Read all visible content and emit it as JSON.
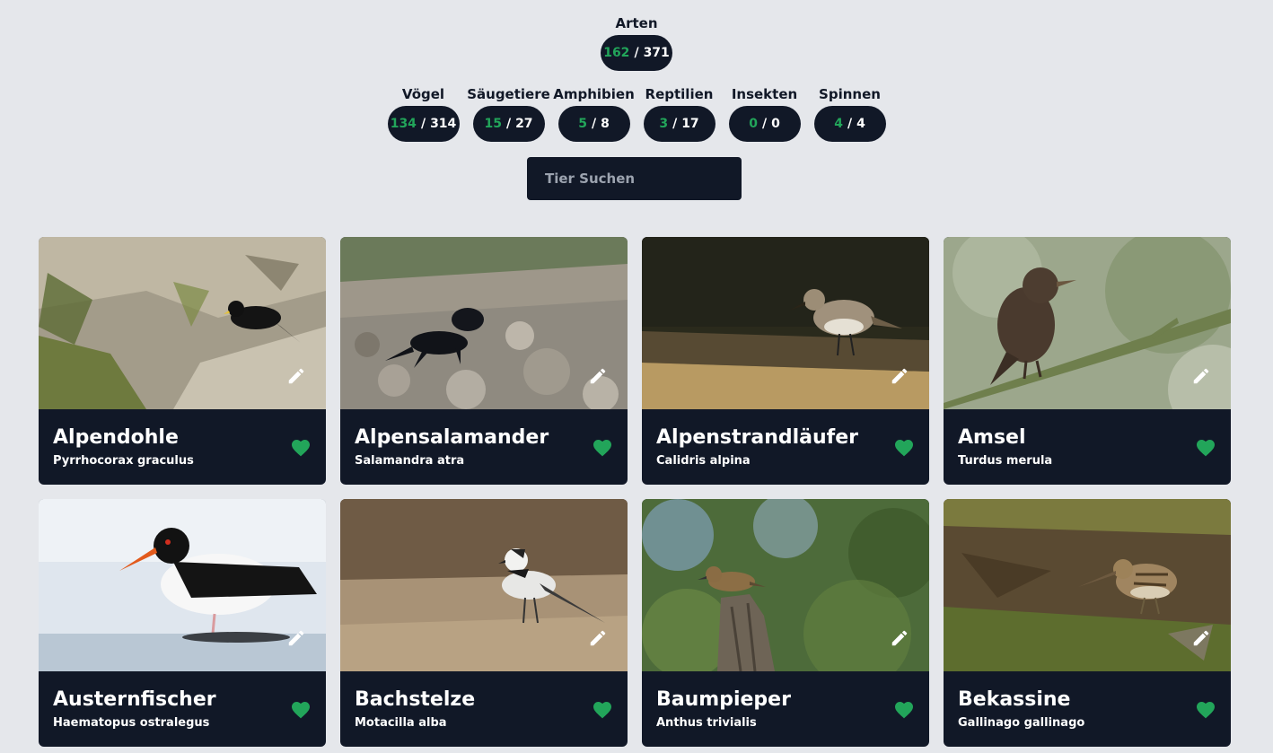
{
  "summary": {
    "label": "Arten",
    "found": "162",
    "total": "371"
  },
  "categories": [
    {
      "label": "Vögel",
      "found": "134",
      "total": "314"
    },
    {
      "label": "Säugetiere",
      "found": "15",
      "total": "27"
    },
    {
      "label": "Amphibien",
      "found": "5",
      "total": "8"
    },
    {
      "label": "Reptilien",
      "found": "3",
      "total": "17"
    },
    {
      "label": "Insekten",
      "found": "0",
      "total": "0"
    },
    {
      "label": "Spinnen",
      "found": "4",
      "total": "4"
    }
  ],
  "search": {
    "placeholder": "Tier Suchen"
  },
  "colors": {
    "background": "#e5e7eb",
    "panel": "#111827",
    "found": "#22a55a",
    "heart": "#22a55a"
  },
  "icons": {
    "edit": "pencil-icon",
    "favorite": "heart-icon"
  },
  "cards": [
    {
      "name": "Alpendohle",
      "latin": "Pyrrhocorax graculus"
    },
    {
      "name": "Alpensalamander",
      "latin": "Salamandra atra"
    },
    {
      "name": "Alpenstrandläufer",
      "latin": "Calidris alpina"
    },
    {
      "name": "Amsel",
      "latin": "Turdus merula"
    },
    {
      "name": "Austernfischer",
      "latin": "Haematopus ostralegus"
    },
    {
      "name": "Bachstelze",
      "latin": "Motacilla alba"
    },
    {
      "name": "Baumpieper",
      "latin": "Anthus trivialis"
    },
    {
      "name": "Bekassine",
      "latin": "Gallinago gallinago"
    }
  ]
}
